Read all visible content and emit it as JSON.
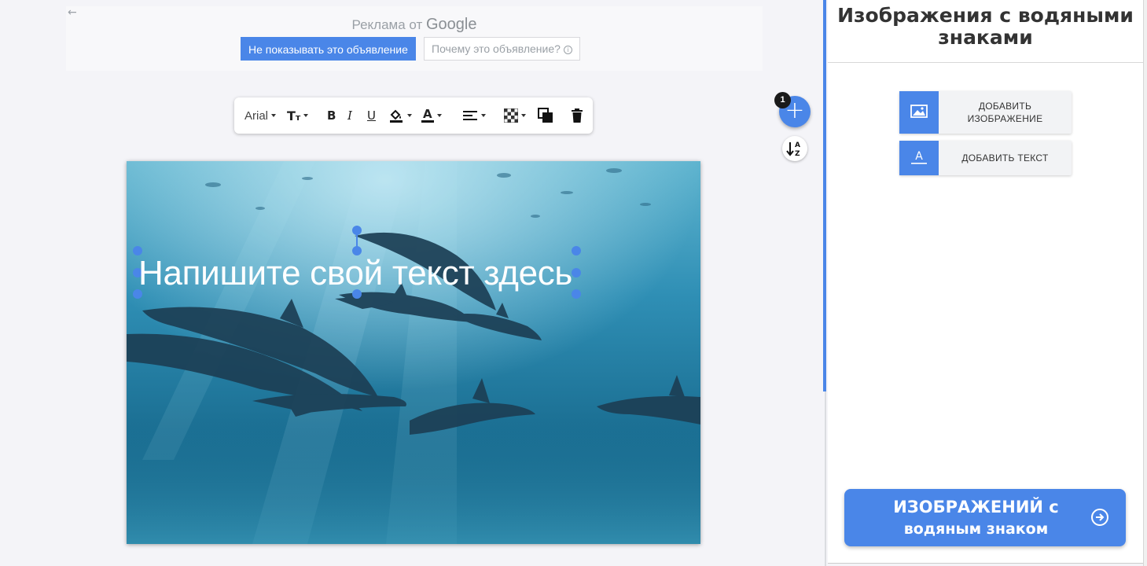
{
  "ad": {
    "back_glyph": "←",
    "label": "Реклама от",
    "brand": "Google",
    "hide_button": "Не показывать это объявление",
    "why_button": "Почему это объявление?",
    "info_glyph": "i"
  },
  "toolbar": {
    "font": "Arial",
    "text_size_big": "T",
    "text_size_small": "т",
    "bold": "B",
    "italic": "I",
    "underline": "U",
    "font_color": "A"
  },
  "fab": {
    "add": "+",
    "badge": "1"
  },
  "canvas": {
    "watermark_text": "Напишите свой текст здесь"
  },
  "panel": {
    "title": "Изображения с водяными знаками",
    "add_image": "ДОБАВИТЬ ИЗОБРАЖЕНИЕ",
    "add_text": "ДОБАВИТЬ ТЕКСТ",
    "export_line1": "ИЗОБРАЖЕНИЙ с",
    "export_line2": "водяным знаком"
  },
  "colors": {
    "accent": "#4a86e8",
    "panel_bg": "#ffffff",
    "page_bg": "#f4f4f8"
  }
}
